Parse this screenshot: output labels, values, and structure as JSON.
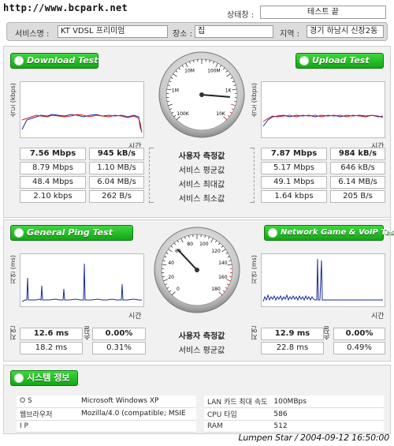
{
  "watermark": "http://www.bcpark.net",
  "status": {
    "label": "상태창 :",
    "value": "테스트 끝"
  },
  "info": {
    "service_label": "서비스명 :",
    "service_value": "KT VDSL 프리미엄",
    "place_label": "장소 :",
    "place_value": "집",
    "region_label": "지역 :",
    "region_value": "경기 하남시 신장2동"
  },
  "download": {
    "button": "Download Test",
    "ylabel": "속도 (kbps)",
    "xlabel": "시간",
    "rows": [
      {
        "a": "7.56 Mbps",
        "b": "945 kB/s"
      },
      {
        "a": "8.79 Mbps",
        "b": "1.10 MB/s"
      },
      {
        "a": "48.4 Mbps",
        "b": "6.04 MB/s"
      },
      {
        "a": "2.10 kbps",
        "b": "262 B/s"
      }
    ]
  },
  "upload": {
    "button": "Upload Test",
    "ylabel": "속도 (kbps)",
    "xlabel": "시간",
    "rows": [
      {
        "a": "7.87 Mbps",
        "b": "984 kB/s"
      },
      {
        "a": "5.17 Mbps",
        "b": "646 kB/s"
      },
      {
        "a": "49.1 Mbps",
        "b": "6.14 MB/s"
      },
      {
        "a": "1.64 kbps",
        "b": "205 B/s"
      }
    ]
  },
  "speed_labels": [
    "사용자 측정값",
    "서비스 평균값",
    "서비스 최대값",
    "서비스 최소값"
  ],
  "speed_gauge": {
    "ticks": [
      "100K",
      "1M",
      "10M",
      "100M",
      "1K",
      "10K"
    ],
    "needle_fraction": 0.85
  },
  "ping": {
    "button": "General Ping Test",
    "ylabel": "지연 (ms)",
    "xlabel": "시간",
    "latency_label": "지연",
    "loss_label": "손실",
    "rows": [
      {
        "a": "12.6 ms",
        "b": "0.00%"
      },
      {
        "a": "18.2 ms",
        "b": "0.31%"
      }
    ]
  },
  "game": {
    "button": "Network Game & VoIP Test",
    "ylabel": "지연 (ms)",
    "xlabel": "시간",
    "latency_label": "지연",
    "loss_label": "손실",
    "rows": [
      {
        "a": "12.9 ms",
        "b": "0.00%"
      },
      {
        "a": "22.8 ms",
        "b": "0.49%"
      }
    ]
  },
  "ping_labels": [
    "사용자 측정값",
    "서비스 평균값"
  ],
  "ping_gauge": {
    "ticks": [
      "0",
      "20",
      "40",
      "60",
      "80",
      "100",
      "120",
      "140",
      "160",
      "180"
    ],
    "needle_fraction": 0.34
  },
  "system": {
    "button": "시스템 정보",
    "left": [
      {
        "k": "O S",
        "v": "Microsoft Windows XP"
      },
      {
        "k": "웹브라우저",
        "v": "Mozilla/4.0 (compatible; MSIE"
      },
      {
        "k": "I P",
        "v": ""
      }
    ],
    "right": [
      {
        "k": "LAN 카드 최대 속도",
        "v": "100MBps"
      },
      {
        "k": "CPU 타입",
        "v": "586"
      },
      {
        "k": "RAM",
        "v": "512"
      }
    ]
  },
  "footer": "Lumpen Star / 2004-09-12 16:50:00",
  "colors": {
    "accent": "#1fb51f",
    "series_red": "#cc2222",
    "series_blue": "#1b2aa0"
  }
}
